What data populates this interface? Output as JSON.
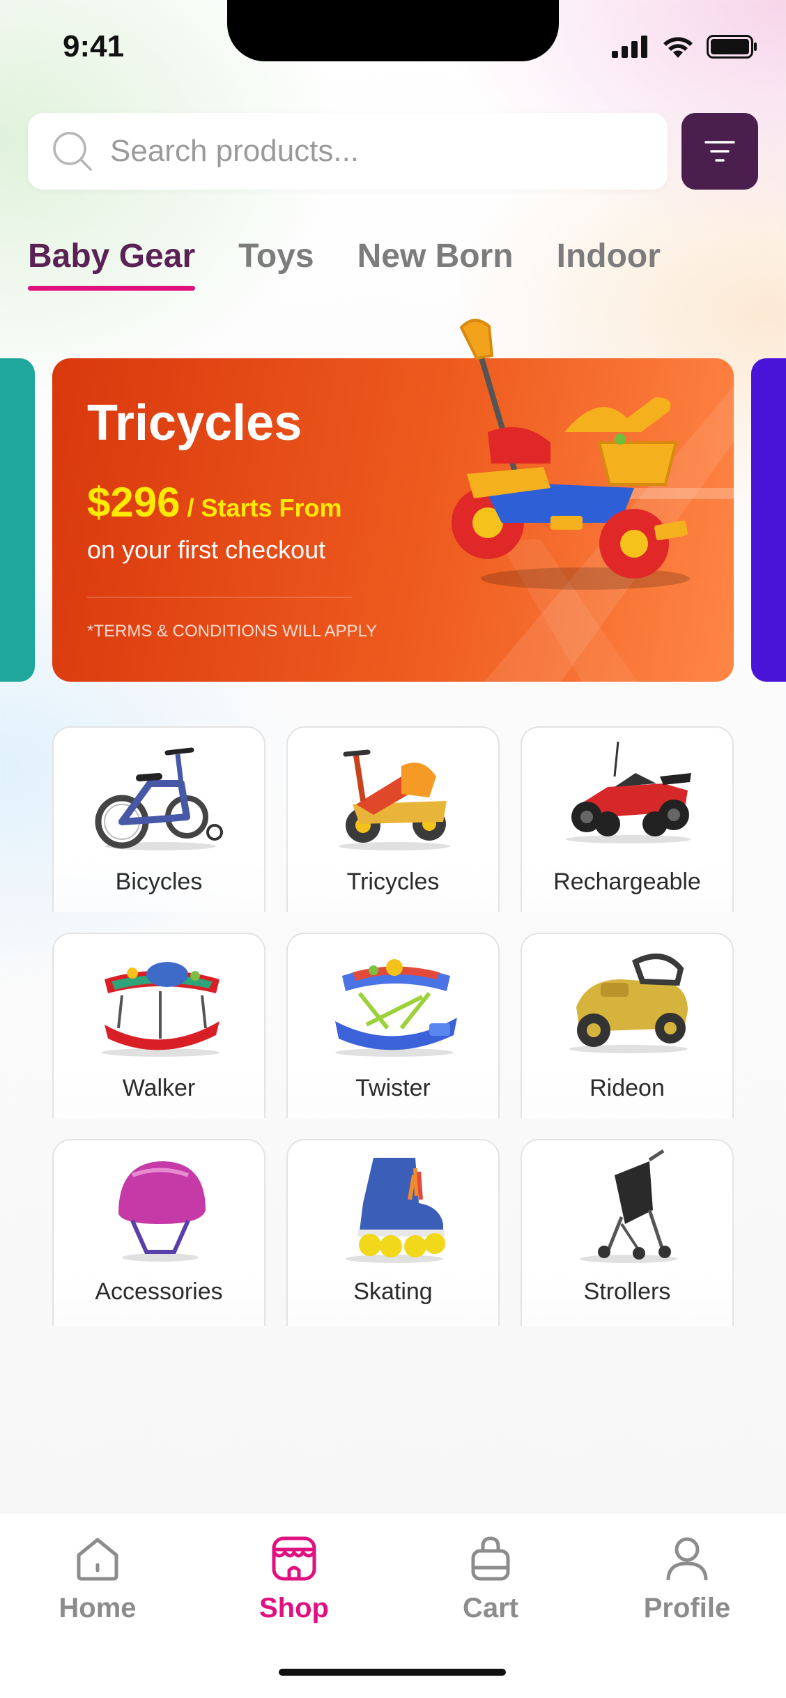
{
  "status_bar": {
    "time": "9:41"
  },
  "search": {
    "placeholder": "Search products..."
  },
  "tabs": [
    {
      "label": "Baby Gear",
      "active": true
    },
    {
      "label": "Toys",
      "active": false
    },
    {
      "label": "New Born",
      "active": false
    },
    {
      "label": "Indoor",
      "active": false
    }
  ],
  "banner": {
    "title": "Tricycles",
    "price": "$296",
    "price_suffix": " / Starts From",
    "subtitle": "on your first checkout",
    "terms": "*TERMS & CONDITIONS WILL APPLY",
    "colors": {
      "background": "#e84a18",
      "price": "#ffea00",
      "left_card": "#1fa79b",
      "right_card": "#4a14d8"
    }
  },
  "categories": [
    {
      "label": "Bicycles",
      "icon": "bicycle-icon"
    },
    {
      "label": "Tricycles",
      "icon": "tricycle-icon"
    },
    {
      "label": "Rechargeable",
      "icon": "rc-car-icon"
    },
    {
      "label": "Walker",
      "icon": "walker-icon"
    },
    {
      "label": "Twister",
      "icon": "twister-icon"
    },
    {
      "label": "Rideon",
      "icon": "rideon-car-icon"
    },
    {
      "label": "Accessories",
      "icon": "helmet-icon"
    },
    {
      "label": "Skating",
      "icon": "roller-skate-icon"
    },
    {
      "label": "Strollers",
      "icon": "stroller-icon"
    }
  ],
  "bottom_nav": [
    {
      "label": "Home",
      "icon": "home-icon",
      "active": false
    },
    {
      "label": "Shop",
      "icon": "shop-icon",
      "active": true
    },
    {
      "label": "Cart",
      "icon": "cart-bag-icon",
      "active": false
    },
    {
      "label": "Profile",
      "icon": "profile-icon",
      "active": false
    }
  ],
  "theme": {
    "accent": "#e0107f",
    "primary_dark": "#4a1f4e",
    "tab_active": "#5a2155"
  }
}
